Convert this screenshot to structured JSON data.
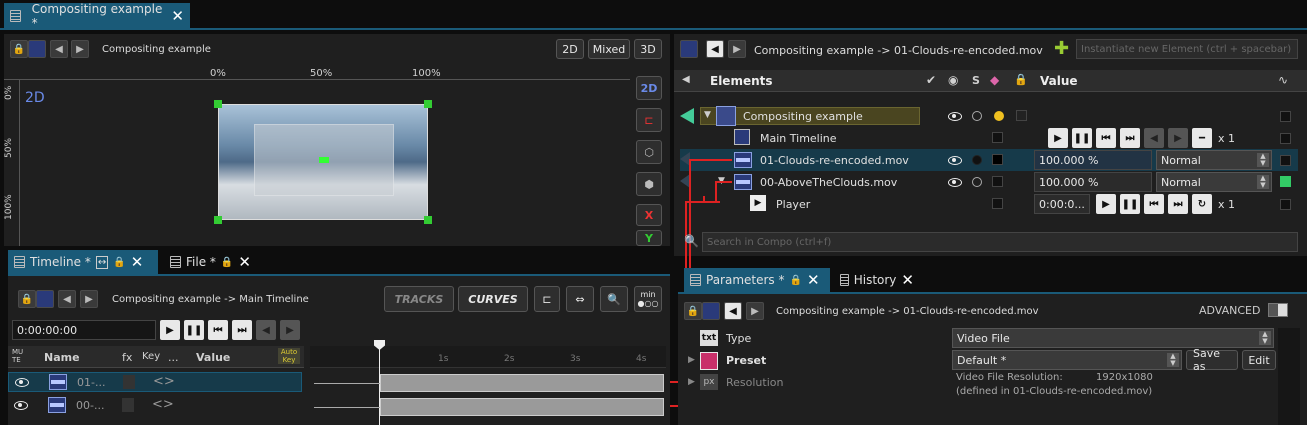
{
  "top_tab": {
    "title": "Compositing example *"
  },
  "viewer": {
    "breadcrumb": "Compositing example",
    "mode_buttons": [
      "2D",
      "Mixed",
      "3D"
    ],
    "ruler_h": [
      "0%",
      "50%",
      "100%"
    ],
    "ruler_v": [
      "0%",
      "50%",
      "100%"
    ],
    "view_label": "2D",
    "side_buttons": [
      "2D",
      "X",
      "Y"
    ]
  },
  "elements": {
    "breadcrumb": "Compositing example -> 01-Clouds-re-encoded.mov",
    "instantiate_placeholder": "Instantiate new Element (ctrl + spacebar)",
    "header": {
      "elements": "Elements",
      "s": "S",
      "value": "Value"
    },
    "rows": [
      {
        "name": "Compositing example"
      },
      {
        "name": "Main Timeline",
        "speed": "x 1"
      },
      {
        "name": "01-Clouds-re-encoded.mov",
        "opacity": "100.000 %",
        "blend": "Normal"
      },
      {
        "name": "00-AboveTheClouds.mov",
        "opacity": "100.000 %",
        "blend": "Normal"
      },
      {
        "name": "Player",
        "time": "0:00:0...",
        "speed": "x 1"
      }
    ],
    "search_placeholder": "Search in Compo (ctrl+f)"
  },
  "timeline": {
    "tabs": [
      {
        "label": "Timeline *"
      },
      {
        "label": "File *"
      }
    ],
    "breadcrumb": "Compositing example -> Main Timeline",
    "mode_buttons": [
      "TRACKS",
      "CURVES"
    ],
    "min_label": "min",
    "timecode": "0:00:00:00",
    "columns": {
      "mute": "MU TE",
      "name": "Name",
      "fx": "fx",
      "key": "Key",
      "dots": "...",
      "value": "Value",
      "autokey": "Auto Key"
    },
    "ruler": [
      "1s",
      "2s",
      "3s",
      "4s"
    ],
    "tracks": [
      {
        "name": "01-..."
      },
      {
        "name": "00-..."
      }
    ]
  },
  "parameters": {
    "tabs": [
      {
        "label": "Parameters *"
      },
      {
        "label": "History"
      }
    ],
    "breadcrumb": "Compositing example -> 01-Clouds-re-encoded.mov",
    "advanced_label": "ADVANCED",
    "rows": [
      {
        "icon": "txt",
        "label": "Type",
        "value": "Video File"
      },
      {
        "label": "Preset",
        "value": "Default *",
        "save_as": "Save as",
        "edit": "Edit"
      },
      {
        "icon": "px",
        "label": "Resolution",
        "info_label": "Video File Resolution:",
        "info_value": "1920x1080",
        "info_note": "(defined in 01-Clouds-re-encoded.mov)"
      }
    ]
  }
}
